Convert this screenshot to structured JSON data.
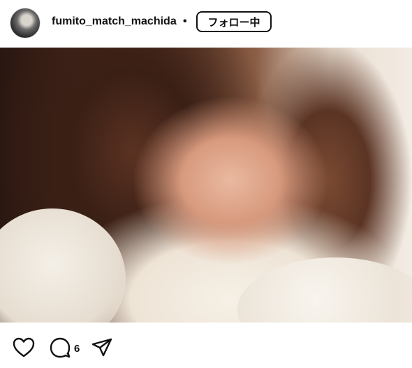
{
  "header": {
    "username": "fumito_match_machida",
    "separator": "•",
    "follow_label": "フォロー中"
  },
  "post": {
    "photo_icon": "photo-image"
  },
  "actions": {
    "comment_count": "6",
    "like_icon": "heart-icon",
    "comment_icon": "comment-icon",
    "share_icon": "paper-plane-icon"
  }
}
